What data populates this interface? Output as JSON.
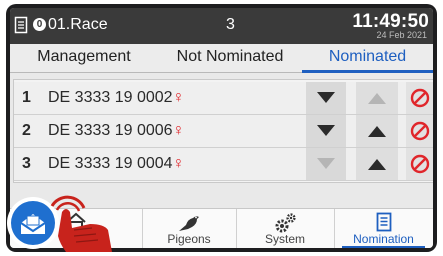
{
  "statusbar": {
    "race_badge": "0",
    "race_name": "01.Race",
    "count": "3",
    "time": "11:49:50",
    "date": "24 Feb 2021"
  },
  "tabs": [
    {
      "label": "Management",
      "active": false
    },
    {
      "label": "Not Nominated",
      "active": false
    },
    {
      "label": "Nominated",
      "active": true
    }
  ],
  "rows": [
    {
      "num": "1",
      "ring": "DE 3333 19 0002",
      "sex": "♀",
      "down_enabled": true,
      "up_enabled": false
    },
    {
      "num": "2",
      "ring": "DE 3333 19 0006",
      "sex": "♀",
      "down_enabled": true,
      "up_enabled": true
    },
    {
      "num": "3",
      "ring": "DE 3333 19 0004",
      "sex": "♀",
      "down_enabled": false,
      "up_enabled": true
    }
  ],
  "nav": [
    {
      "label": "Home",
      "icon": "home-icon",
      "active": false
    },
    {
      "label": "Pigeons",
      "icon": "pigeon-icon",
      "active": false
    },
    {
      "label": "System",
      "icon": "gears-icon",
      "active": false
    },
    {
      "label": "Nomination",
      "icon": "clipboard-icon",
      "active": true
    }
  ],
  "colors": {
    "accent": "#1e5fc0",
    "statusbar_bg": "#3a3a3a",
    "delete_red": "#e0262b",
    "hand_red": "#c8231c",
    "fab_blue": "#1f6fcf"
  }
}
